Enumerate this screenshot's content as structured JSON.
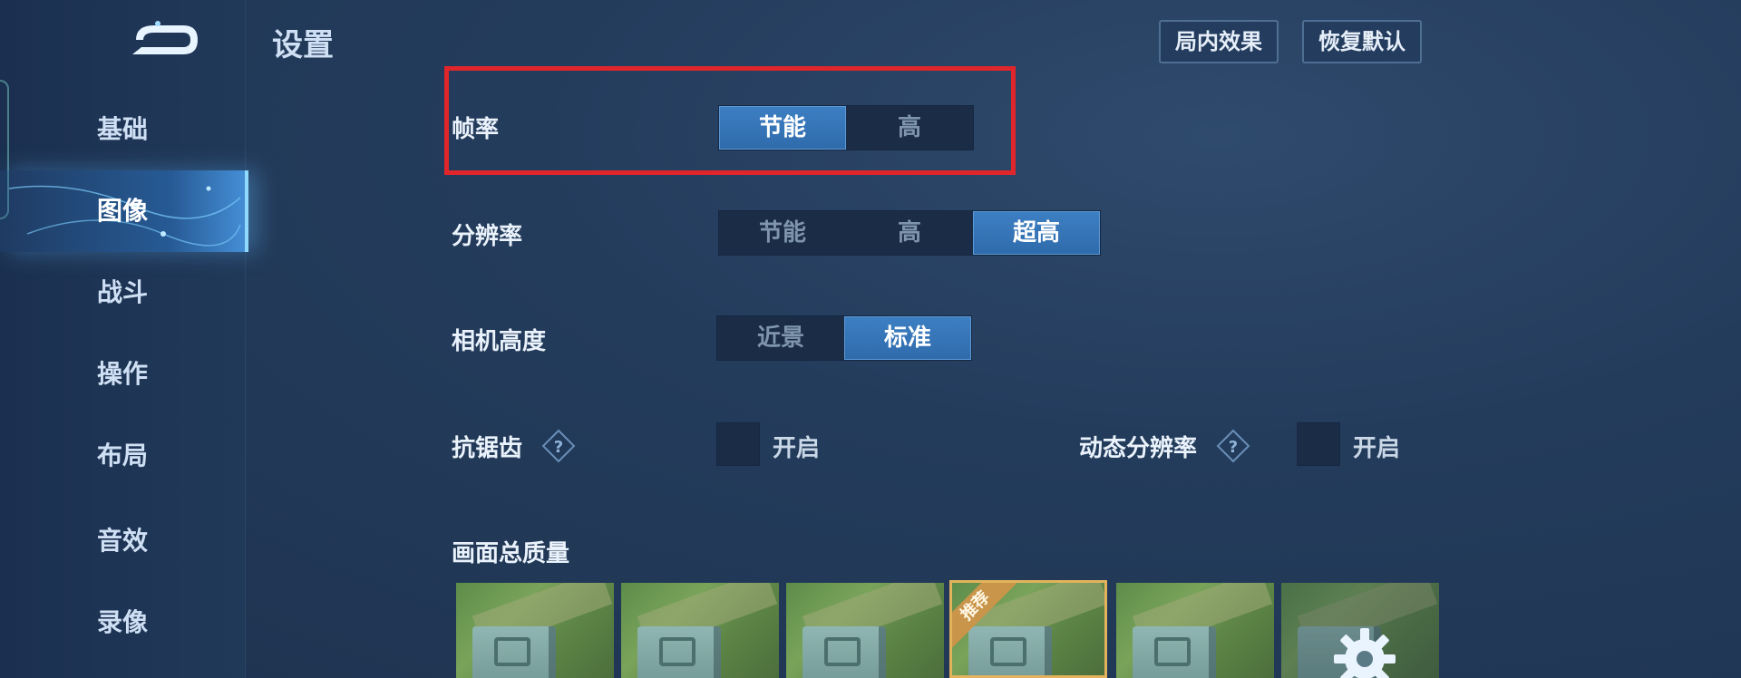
{
  "page_title": "设置",
  "top_buttons": {
    "in_game_effects": "局内效果",
    "restore_defaults": "恢复默认"
  },
  "sidebar": {
    "items": [
      {
        "label": "基础"
      },
      {
        "label": "图像",
        "active": true
      },
      {
        "label": "战斗"
      },
      {
        "label": "操作"
      },
      {
        "label": "布局"
      },
      {
        "label": "音效"
      },
      {
        "label": "录像"
      }
    ]
  },
  "settings": {
    "frame_rate": {
      "label": "帧率",
      "options": [
        "节能",
        "高"
      ],
      "selected": "节能"
    },
    "resolution": {
      "label": "分辨率",
      "options": [
        "节能",
        "高",
        "超高"
      ],
      "selected": "超高"
    },
    "camera_height": {
      "label": "相机高度",
      "options": [
        "近景",
        "标准"
      ],
      "selected": "标准"
    },
    "anti_aliasing": {
      "label": "抗锯齿",
      "toggle_label": "开启",
      "checked": false
    },
    "dynamic_resolution": {
      "label": "动态分辨率",
      "toggle_label": "开启",
      "checked": false
    },
    "overall_quality": {
      "label": "画面总质量",
      "presets": [
        {
          "recommended": false
        },
        {
          "recommended": false
        },
        {
          "recommended": false
        },
        {
          "recommended": true,
          "badge": "推荐"
        },
        {
          "recommended": false
        },
        {
          "custom": true,
          "icon": "gear-icon"
        }
      ]
    }
  },
  "colors": {
    "highlight_border": "#e0262b",
    "selected_option": "#3a7bc0",
    "recommended_border": "#e2b35c"
  }
}
